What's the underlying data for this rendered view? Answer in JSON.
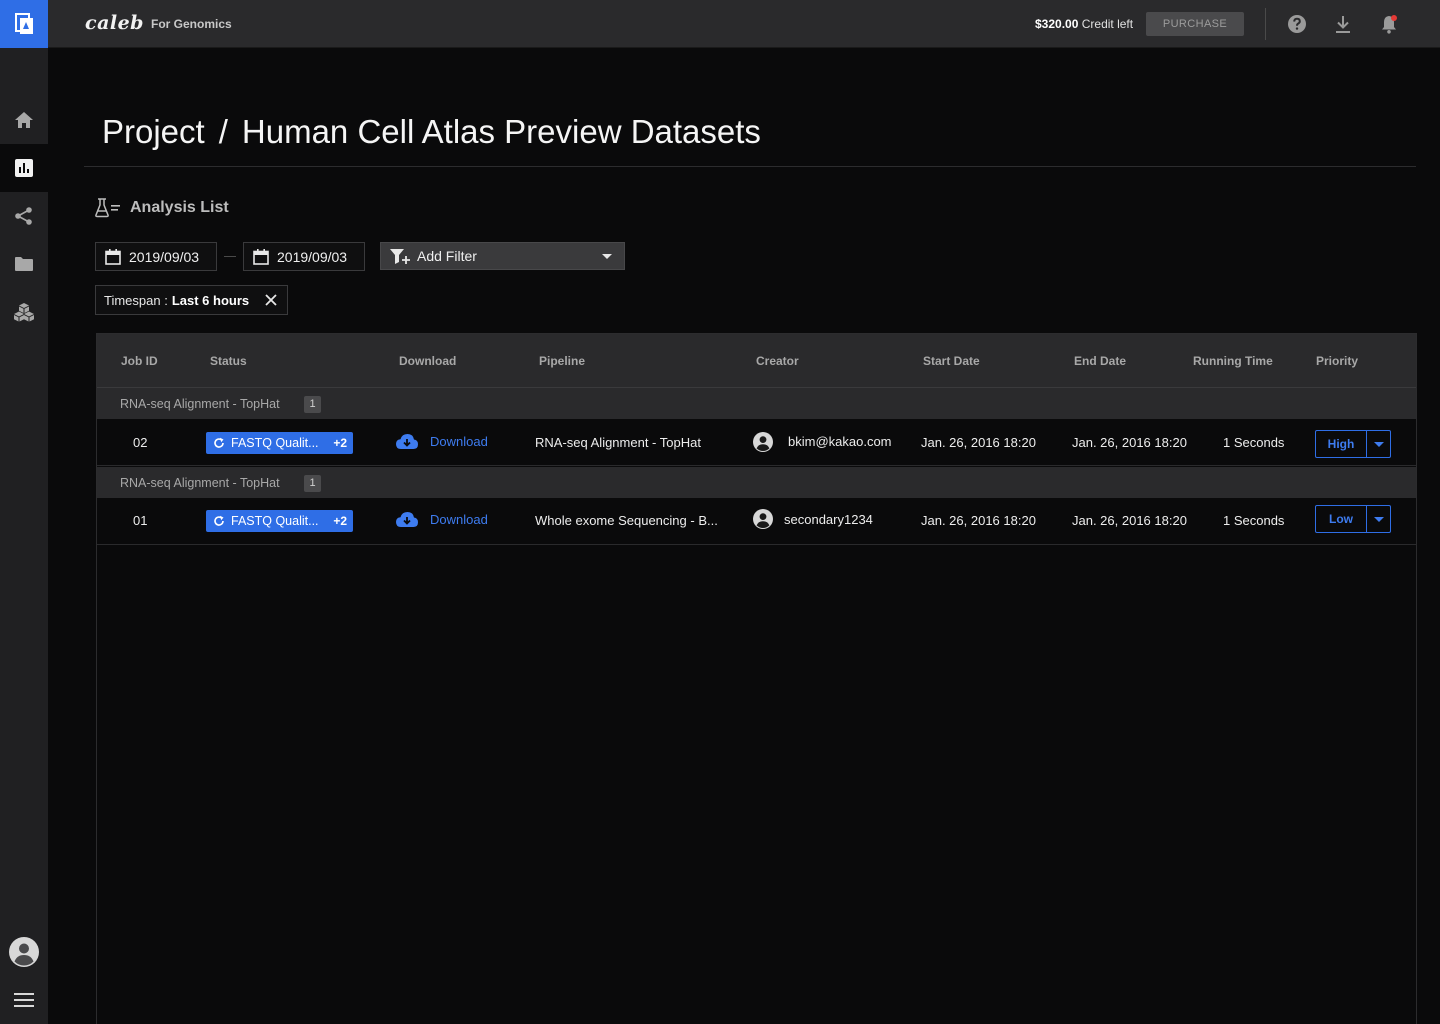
{
  "app": {
    "brand": "caleb",
    "brand_sub": "For Genomics"
  },
  "topbar": {
    "credit_amount": "$320.00",
    "credit_label": "Credit left",
    "purchase_label": "PURCHASE"
  },
  "page": {
    "title_prefix": "Project",
    "title_sep": "/",
    "title_main": "Human Cell Atlas Preview Datasets"
  },
  "section": {
    "title": "Analysis List"
  },
  "filters": {
    "date_from": "2019/09/03",
    "date_to": "2019/09/03",
    "add_filter_label": "Add Filter",
    "chip_key": "Timespan :",
    "chip_value": "Last 6 hours"
  },
  "table": {
    "headers": [
      "Job ID",
      "Status",
      "Download",
      "Pipeline",
      "Creator",
      "Start Date",
      "End Date",
      "Running Time",
      "Priority"
    ],
    "groups": [
      {
        "label": "RNA-seq Alignment - TopHat",
        "count": "1",
        "row": {
          "job_id": "02",
          "status": "FASTQ Qualit...",
          "status_more": "+2",
          "download": "Download",
          "pipeline": "RNA-seq Alignment - TopHat",
          "creator": "bkim@kakao.com",
          "start": "Jan. 26, 2016 18:20",
          "end": "Jan. 26, 2016 18:20",
          "running": "1 Seconds",
          "priority": "High"
        }
      },
      {
        "label": "RNA-seq Alignment - TopHat",
        "count": "1",
        "row": {
          "job_id": "01",
          "status": "FASTQ Qualit...",
          "status_more": "+2",
          "download": "Download",
          "pipeline": "Whole exome Sequencing - B...",
          "creator": "secondary1234",
          "start": "Jan. 26, 2016 18:20",
          "end": "Jan. 26, 2016 18:20",
          "running": "1 Seconds",
          "priority": "Low"
        }
      }
    ]
  },
  "icons": {
    "sidebar": [
      "home-icon",
      "analysis-chart-icon",
      "share-icon",
      "folder-icon",
      "pipeline-cubes-icon",
      "user-avatar-icon",
      "menu-icon"
    ],
    "topbar": [
      "help-icon",
      "download-icon",
      "notification-bell-icon"
    ]
  },
  "colors": {
    "accent": "#2f6ee6",
    "link": "#3e7cf0",
    "topbar_bg": "#2a2a2c",
    "sidebar_bg": "#202022",
    "main_bg": "#0a0a0b"
  }
}
